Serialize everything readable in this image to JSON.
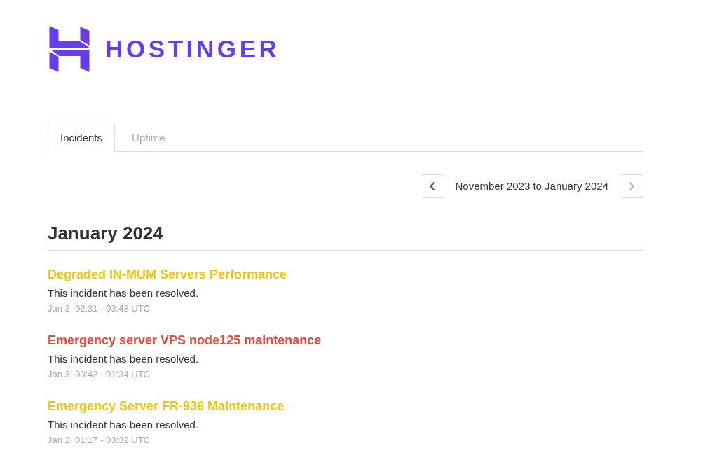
{
  "logo": {
    "text": "HOSTINGER"
  },
  "tabs": [
    {
      "label": "Incidents",
      "selected": true
    },
    {
      "label": "Uptime",
      "selected": false
    }
  ],
  "pager": {
    "range": "November 2023 to January 2024",
    "previous": {
      "disabled": false
    },
    "next": {
      "disabled": true
    }
  },
  "months": [
    {
      "heading": "January 2024",
      "incidents": [
        {
          "title": "Degraded IN-MUM Servers Performance",
          "color": "#f1c40f",
          "message": "This incident has been resolved.",
          "time": "Jan 3, 02:31 - 03:48 UTC"
        },
        {
          "title": "Emergency server VPS node125 maintenance",
          "color": "#e74c3c",
          "message": "This incident has been resolved.",
          "time": "Jan 3, 00:42 - 01:34 UTC"
        },
        {
          "title": "Emergency Server FR-936 Maintenance",
          "color": "#f1c40f",
          "message": "This incident has been resolved.",
          "time": "Jan 2, 01:17 - 03:32 UTC"
        }
      ]
    }
  ]
}
